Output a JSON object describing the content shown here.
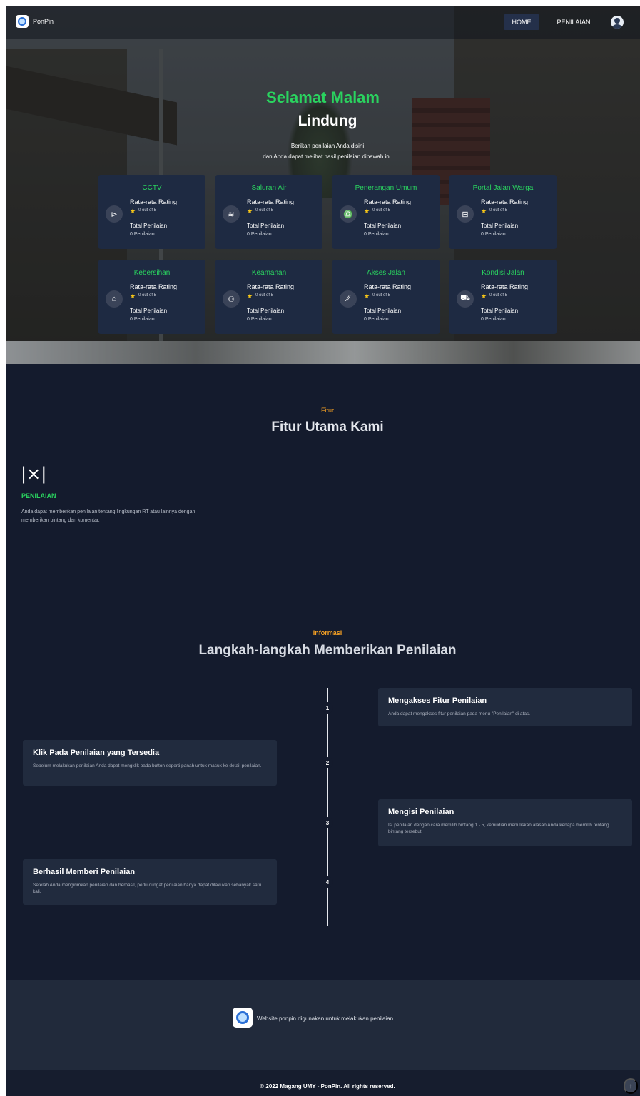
{
  "nav": {
    "brand": "PonPin",
    "home": "HOME",
    "penilaian": "PENILAIAN"
  },
  "hero": {
    "greeting": "Selamat Malam",
    "name": "Lindung",
    "subtitle_1": "Berikan penilaian Anda disini",
    "subtitle_2": "dan Anda dapat melihat hasil penilaian dibawah ini."
  },
  "ratings": {
    "rating_label": "Rata-rata Rating",
    "score_text": "0 out of 5",
    "total_label": "Total Penilaian",
    "total_value": "0 Penilaian",
    "cards": [
      {
        "title": "CCTV",
        "icon": "cctv-icon"
      },
      {
        "title": "Saluran Air",
        "icon": "water-channel-icon"
      },
      {
        "title": "Penerangan Umum",
        "icon": "street-light-icon"
      },
      {
        "title": "Portal Jalan Warga",
        "icon": "gate-icon"
      },
      {
        "title": "Kebersihan",
        "icon": "trash-icon"
      },
      {
        "title": "Keamanan",
        "icon": "security-icon"
      },
      {
        "title": "Akses Jalan",
        "icon": "road-icon"
      },
      {
        "title": "Kondisi Jalan",
        "icon": "car-icon"
      }
    ]
  },
  "fitur": {
    "tag": "Fitur",
    "title": "Fitur Utama Kami",
    "icon_glyph": "|×|",
    "heading": "PENILAIAN",
    "desc": "Anda dapat memberikan penilaian tentang lingkungan RT atau lainnya dengan memberikan bintang dan komentar."
  },
  "informasi": {
    "tag": "Informasi",
    "title": "Langkah-langkah Memberikan Penilaian",
    "steps": [
      {
        "num": "1",
        "title": "Mengakses Fitur Penilaian",
        "desc": "Anda dapat mengakses fitur penilaian pada menu \"Penilaian\" di atas."
      },
      {
        "num": "2",
        "title": "Klik Pada Penilaian yang Tersedia",
        "desc": "Sebelum melakukan penilaian Anda dapat mengklik pada button seperti panah untuk masuk ke detail penilaian."
      },
      {
        "num": "3",
        "title": "Mengisi Penilaian",
        "desc": "Isi penilaian dengan cara memilih bintang 1 - 5, kemudian menuliskan alasan Anda kenapa memilih rentang bintang tersebut."
      },
      {
        "num": "4",
        "title": "Berhasil Memberi Penilaian",
        "desc": "Setelah Anda mengirimkan penilaian dan berhasil, perlu diingat penilaian hanya dapat dilakukan sebanyak satu kali."
      }
    ]
  },
  "footer": {
    "text": "Website ponpin digunakan untuk melakukan penilaian.",
    "copyright": "© 2022 Magang UMY - PonPin. All rights reserved.",
    "to_top": "↑"
  },
  "colors": {
    "accent_green": "#2ad35f",
    "accent_orange": "#f5a023",
    "bg_dark": "#141b2d",
    "card_bg": "#1e2a42"
  }
}
